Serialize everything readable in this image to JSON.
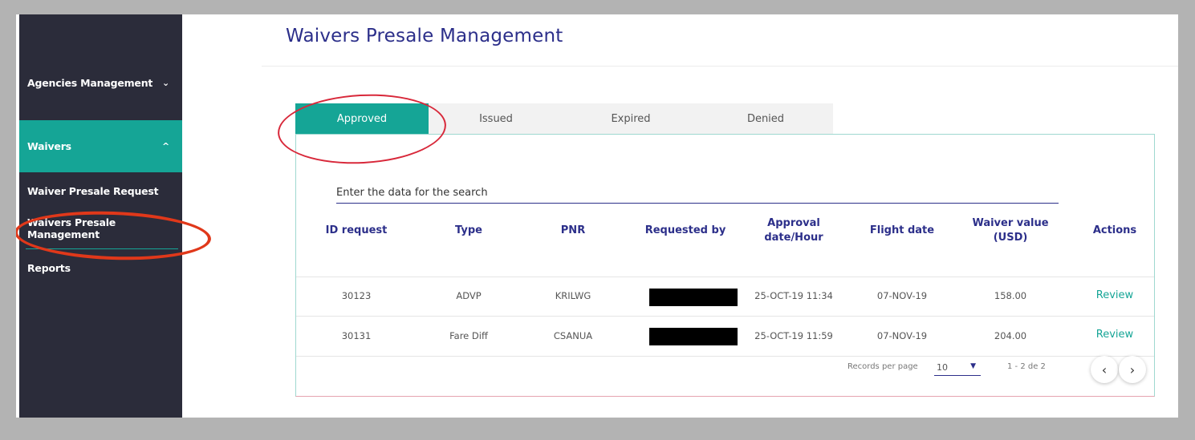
{
  "sidebar": {
    "agencies": {
      "label": "Agencies Management",
      "icon": "chevron-down-icon",
      "chev": "⌄"
    },
    "waivers": {
      "label": "Waivers",
      "icon": "chevron-up-icon",
      "chev": "^"
    },
    "sub": [
      "Waiver Presale Request",
      "Waivers Presale Management"
    ],
    "reports": "Reports"
  },
  "page": {
    "title": "Waivers Presale Management"
  },
  "tabs": [
    "Approved",
    "Issued",
    "Expired",
    "Denied"
  ],
  "search": {
    "placeholder": "Enter the data for the search"
  },
  "table": {
    "headers": [
      "ID request",
      "Type",
      "PNR",
      "Requested by",
      "Approval date/Hour",
      "Flight date",
      "Waiver value (USD)",
      "Actions"
    ],
    "rows": [
      [
        "30123",
        "ADVP",
        "KRILWG",
        "",
        "25-OCT-19 11:34",
        "07-NOV-19",
        "158.00",
        "Review"
      ],
      [
        "30131",
        "Fare Diff",
        "CSANUA",
        "",
        "25-OCT-19 11:59",
        "07-NOV-19",
        "204.00",
        "Review"
      ]
    ]
  },
  "pager": {
    "label": "Records per page",
    "size": "10",
    "caret": "▼",
    "range": "1 - 2 de 2",
    "prev": "‹",
    "next": "›"
  },
  "colors": {
    "accent": "#15a596",
    "brand": "#2c2f8a",
    "sidebar": "#2b2c3a",
    "annotation": "#d8283a"
  }
}
